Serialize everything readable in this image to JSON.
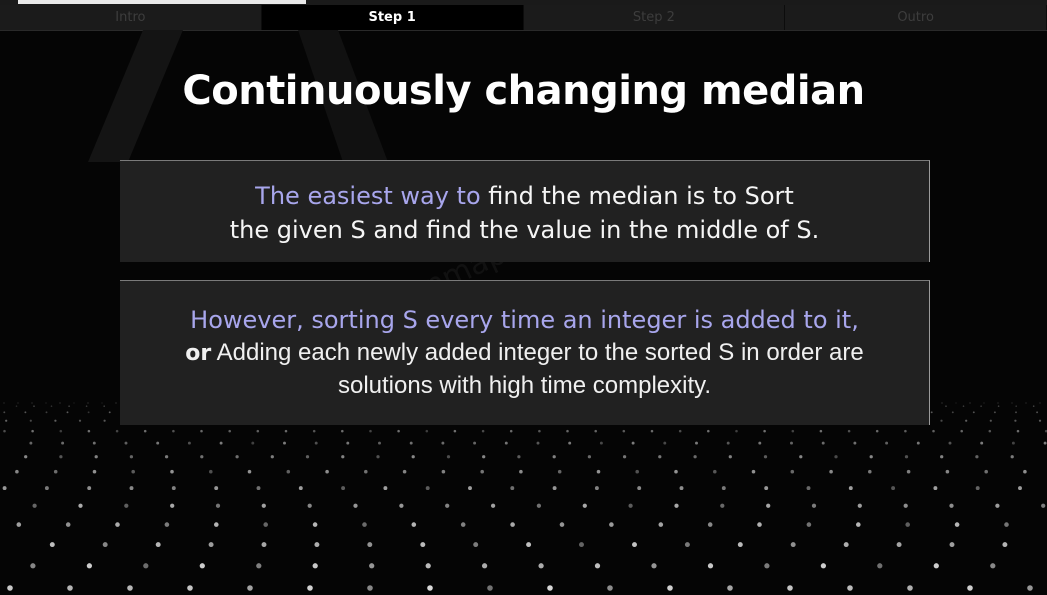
{
  "progress": {
    "value": 0.28
  },
  "tabs": [
    {
      "label": "Intro",
      "active": false
    },
    {
      "label": "Step 1",
      "active": true
    },
    {
      "label": "Step 2",
      "active": false
    },
    {
      "label": "Outro",
      "active": false
    }
  ],
  "slide": {
    "title": "Continuously changing median",
    "card1": {
      "highlight": "The easiest way to",
      "line1_rest": " find the median is to Sort",
      "line2": "the given S and find the value in the middle of S."
    },
    "card2": {
      "highlight": "However, sorting S every time an integer is added to it,",
      "or_label": "or",
      "line2": " Adding each newly added integer to the sorted S in order are",
      "line3": "solutions with high time complexity."
    },
    "watermark": "yunmap@g"
  },
  "colors": {
    "highlight": "#a8a6ec",
    "card_bg": "#212121",
    "background": "#050505"
  }
}
